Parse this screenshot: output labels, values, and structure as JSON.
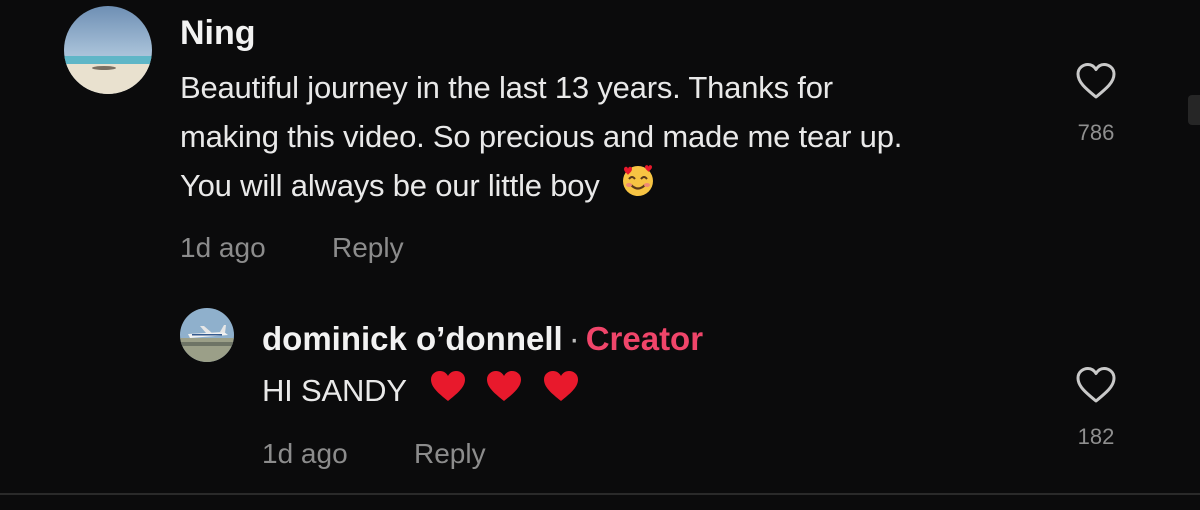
{
  "comments": [
    {
      "username": "Ning",
      "text_lines": [
        "Beautiful journey in the last 13 years. Thanks for",
        "making this video. So precious and made me tear up.",
        "You will always be our little boy"
      ],
      "emoji": "smiling-face-with-hearts",
      "time": "1d ago",
      "reply_label": "Reply",
      "like_count": "786",
      "avatar": "beach-photo"
    },
    {
      "username": "dominick o’donnell",
      "separator": "·",
      "badge": "Creator",
      "text": "HI SANDY",
      "emojis": [
        "red-heart",
        "red-heart",
        "red-heart"
      ],
      "time": "1d ago",
      "reply_label": "Reply",
      "like_count": "182",
      "avatar": "airplane-photo"
    }
  ],
  "colors": {
    "background": "#0b0b0c",
    "creator_badge": "#f0456a",
    "meta_text": "#8c8c8c",
    "heart_emoji": "#e8192c"
  },
  "icons": [
    "heart-outline-icon",
    "heart-outline-icon"
  ]
}
